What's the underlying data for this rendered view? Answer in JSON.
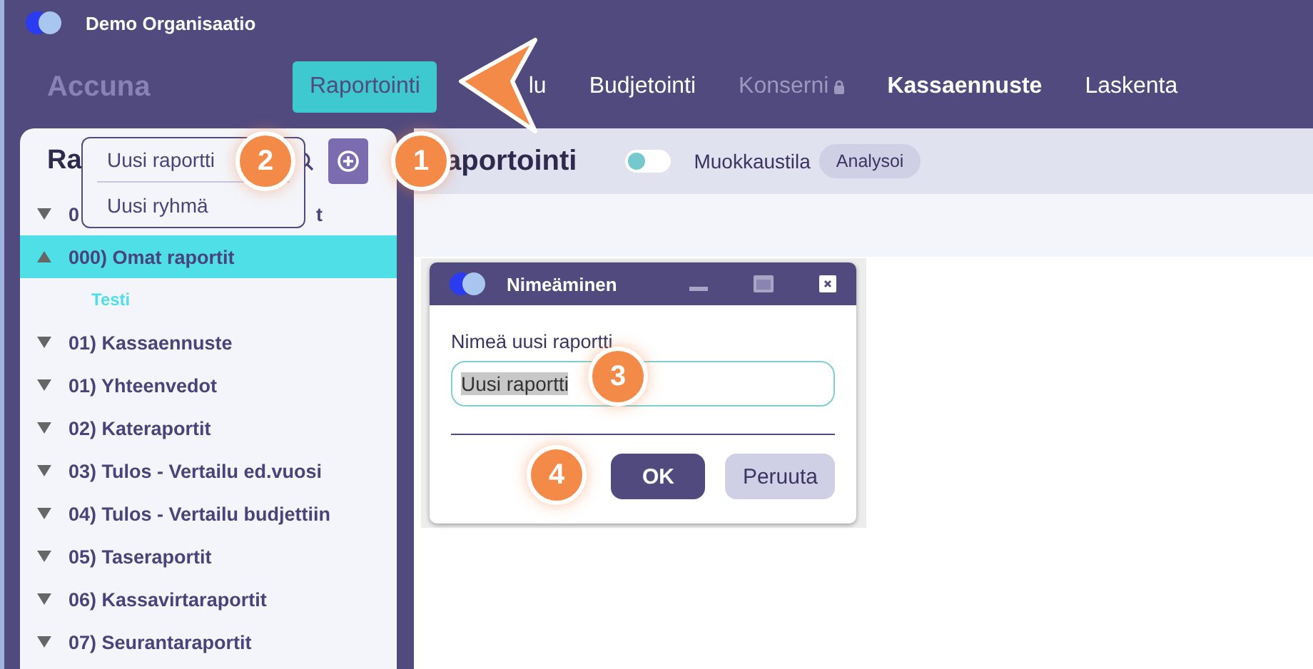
{
  "top_bar": {
    "organisation": "Demo Organisaatio"
  },
  "nav": {
    "brand": "Accuna",
    "items": [
      {
        "label": "Raportointi",
        "selected": true,
        "disabled": false,
        "bold": false
      },
      {
        "label": "lu",
        "selected": false,
        "disabled": false,
        "bold": false
      },
      {
        "label": "Budjetointi",
        "selected": false,
        "disabled": false,
        "bold": false
      },
      {
        "label": "Konserni",
        "selected": false,
        "disabled": true,
        "bold": false
      },
      {
        "label": "Kassaennuste",
        "selected": false,
        "disabled": false,
        "bold": true
      },
      {
        "label": "Laskenta",
        "selected": false,
        "disabled": false,
        "bold": false
      }
    ]
  },
  "sidebar": {
    "title": "Ra",
    "menu": [
      "Uusi raportti",
      "Uusi ryhmä"
    ],
    "items": [
      {
        "label": "0",
        "label_end": "t",
        "expanded": false,
        "selected": false
      },
      {
        "label": "000) Omat raportit",
        "expanded": true,
        "selected": true,
        "children": [
          {
            "label": "Testi"
          }
        ]
      },
      {
        "label": "01) Kassaennuste",
        "expanded": false,
        "selected": false
      },
      {
        "label": "01) Yhteenvedot",
        "expanded": false,
        "selected": false
      },
      {
        "label": "02) Kateraportit",
        "expanded": false,
        "selected": false
      },
      {
        "label": "03) Tulos - Vertailu ed.vuosi",
        "expanded": false,
        "selected": false
      },
      {
        "label": "04) Tulos - Vertailu budjettiin",
        "expanded": false,
        "selected": false
      },
      {
        "label": "05) Taseraportit",
        "expanded": false,
        "selected": false
      },
      {
        "label": "06) Kassavirtaraportit",
        "expanded": false,
        "selected": false
      },
      {
        "label": "07) Seurantaraportit",
        "expanded": false,
        "selected": false
      }
    ]
  },
  "main": {
    "title": "aportointi",
    "edit_mode": {
      "label": "Muokkaustila",
      "on": false
    },
    "analyse_button": "Analysoi"
  },
  "dialog": {
    "title": "Nimeäminen",
    "field_label": "Nimeä uusi raportti",
    "value": "Uusi raportti",
    "value_selected": true,
    "buttons": [
      {
        "label": "OK",
        "kind": "primary"
      },
      {
        "label": "Peruuta",
        "kind": "secondary"
      }
    ]
  },
  "callouts": [
    "1",
    "2",
    "3",
    "4"
  ]
}
